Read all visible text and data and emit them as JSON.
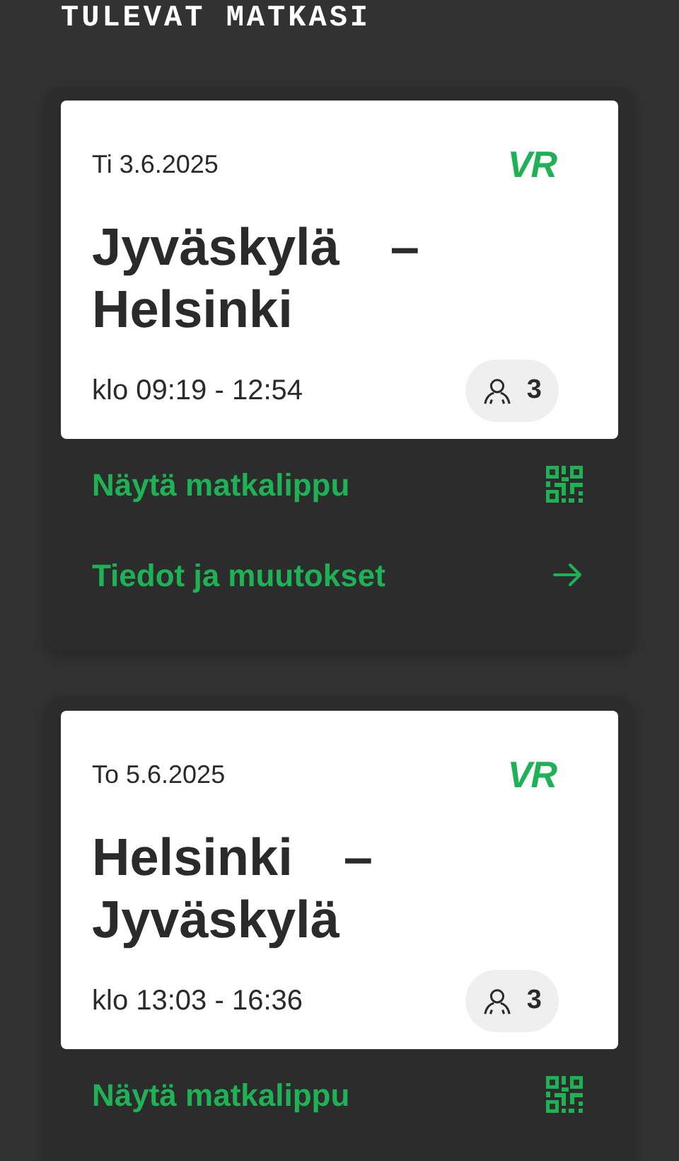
{
  "heading": "TULEVAT MATKASI",
  "trips": [
    {
      "date": "Ti 3.6.2025",
      "logo": "VR",
      "from": "Jyväskylä",
      "separator": "–",
      "to": "Helsinki",
      "time": "klo 09:19 - 12:54",
      "passengers": "3",
      "actions": [
        {
          "kind": "ticket",
          "label": "Näytä matkalippu"
        },
        {
          "kind": "details",
          "label": "Tiedot ja muutokset"
        }
      ]
    },
    {
      "date": "To 5.6.2025",
      "logo": "VR",
      "from": "Helsinki",
      "separator": "–",
      "to": "Jyväskylä",
      "time": "klo 13:03 - 16:36",
      "passengers": "3",
      "actions": [
        {
          "kind": "ticket",
          "label": "Näytä matkalippu"
        }
      ]
    }
  ]
}
